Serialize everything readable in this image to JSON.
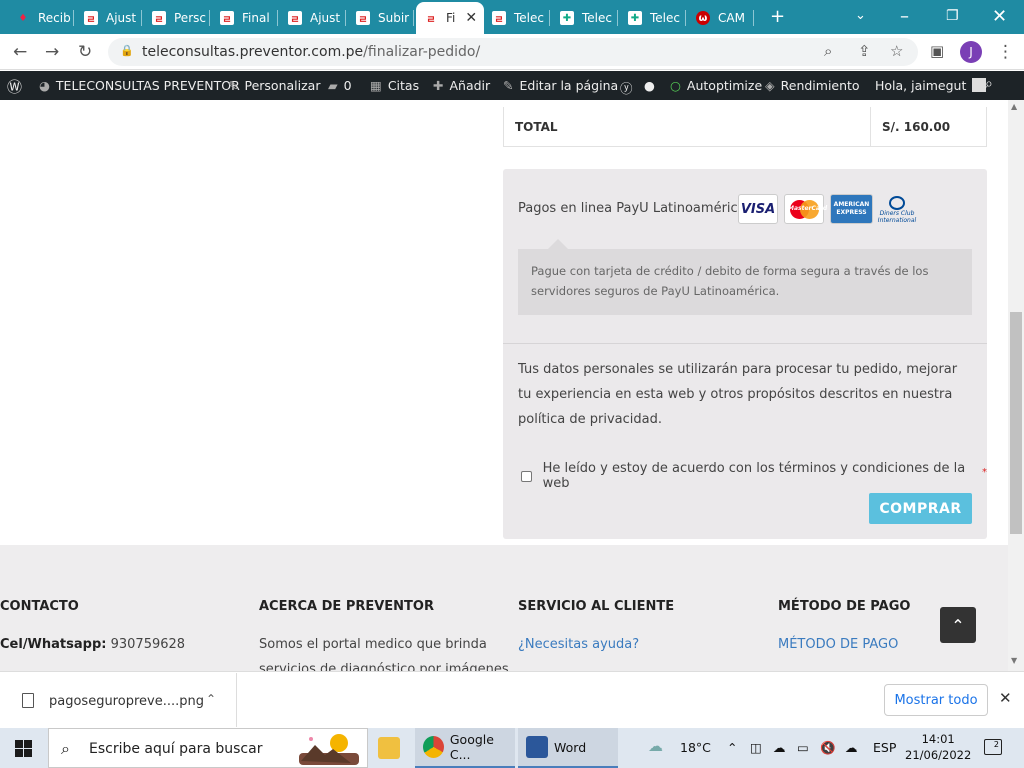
{
  "tabs": [
    {
      "label": "Recib",
      "icon": "rcb"
    },
    {
      "label": "Ajust",
      "icon": "p"
    },
    {
      "label": "Persc",
      "icon": "p"
    },
    {
      "label": "Final",
      "icon": "p"
    },
    {
      "label": "Ajust",
      "icon": "p"
    },
    {
      "label": "Subir",
      "icon": "p"
    },
    {
      "label": "Fi",
      "icon": "p",
      "active": true
    },
    {
      "label": "Telec",
      "icon": "p"
    },
    {
      "label": "Telec",
      "icon": "g"
    },
    {
      "label": "Telec",
      "icon": "g"
    },
    {
      "label": "CAM",
      "icon": "c"
    }
  ],
  "browser": {
    "url_host": "teleconsultas.preventor.com.pe",
    "url_path": "/finalizar-pedido/",
    "profile_initial": "J"
  },
  "wpbar": {
    "site_name": "TELECONSULTAS PREVENTOR",
    "customize": "Personalizar",
    "comments": "0",
    "citas": "Citas",
    "add": "Añadir",
    "edit": "Editar la página",
    "autoptimize": "Autoptimize",
    "performance": "Rendimiento",
    "greeting": "Hola, jaimegut"
  },
  "order": {
    "total_label": "TOTAL",
    "total_value": "S/. 160.00"
  },
  "payment": {
    "method_label": "Pagos en linea PayU Latinoamérica",
    "cards": {
      "visa": "VISA",
      "mastercard": "MasterCard",
      "amex": "AMERICAN EXPRESS",
      "diners": "Diners Club International"
    },
    "description": "Pague con tarjeta de crédito / debito de forma segura a través de los servidores seguros de PayU Latinoamérica.",
    "privacy_text": "Tus datos personales se utilizarán para procesar tu pedido, mejorar tu experiencia en esta web y otros propósitos descritos en nuestra política de privacidad.",
    "terms_label": "He leído y estoy de acuerdo con los términos y condiciones de la web",
    "required_mark": "*",
    "buy_button": "COMPRAR"
  },
  "footer": {
    "col1_title": "CONTACTO",
    "col1_label": "Cel/Whatsapp:",
    "col1_value": "930759628",
    "col2_title": "ACERCA DE PREVENTOR",
    "col2_text": "Somos el portal medico que brinda",
    "col2_text2": "servicios de diagnóstico por imágenes",
    "col3_title": "SERVICIO AL CLIENTE",
    "col3_link": "¿Necesitas ayuda?",
    "col4_title": "MÉTODO DE PAGO",
    "col4_link": "MÉTODO DE PAGO"
  },
  "download": {
    "filename": "pagoseguropreve....png",
    "show_all": "Mostrar todo"
  },
  "taskbar": {
    "search_placeholder": "Escribe aquí para buscar",
    "chrome_label": "Google C...",
    "word_label": "Word",
    "temperature": "18°C",
    "lang": "ESP",
    "time": "14:01",
    "date": "21/06/2022",
    "notifications": "2"
  }
}
